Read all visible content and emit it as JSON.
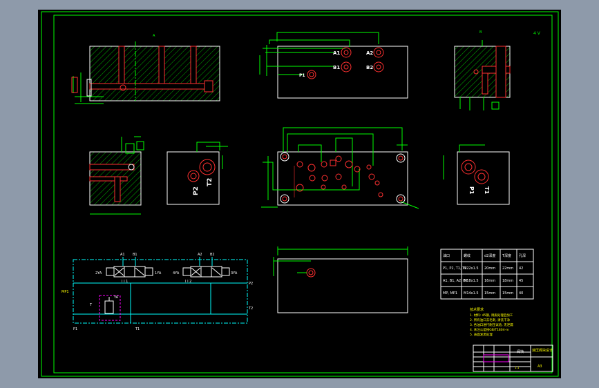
{
  "colors": {
    "background": "#8e9aaa",
    "paper": "#000000",
    "frame": "#00ff00",
    "outline": "#ffffff",
    "dimension": "#00ff00",
    "port": "#ff3030",
    "hatch": "#00c000",
    "schematic": "#00ffff",
    "valve": "#ff00ff",
    "text": "#ffff00"
  },
  "drawing": {
    "sheet_mark": "A3",
    "top_right_label": "4 V",
    "view_label_a": "A",
    "view_label_b": "B",
    "ports_top": {
      "a1": "A1",
      "a2": "A2",
      "b1": "B1",
      "b2": "B2",
      "p": "P1"
    },
    "ports_side": {
      "p2": "P2",
      "t2": "T2",
      "p1": "P1",
      "t1": "T1"
    },
    "schematic_labels": {
      "a1": "A1",
      "b1": "B1",
      "a2": "A2",
      "b2": "B2",
      "p1": "P1",
      "t1": "T1",
      "p2": "P2",
      "t2": "T2",
      "mp": "MP1",
      "t": "T",
      "coil1": "2YA",
      "coil2": "1YA",
      "coil3": "4YA",
      "coil4": "3YA",
      "mid1": "I I 1",
      "mid2": "I I 2",
      "relief": "YA"
    }
  },
  "port_table": {
    "headers": [
      "油口",
      "螺纹",
      "d2深度",
      "T深度",
      "孔深"
    ],
    "rows": [
      [
        "P1, P2, T1, T2",
        "M22x1.5",
        "20mm",
        "22mm",
        "42"
      ],
      [
        "A1, B1, A2, B2",
        "M18x1.5",
        "16mm",
        "18mm",
        "45"
      ],
      [
        "MP, MP1",
        "M14x1.5",
        "15mm",
        "15mm",
        "40"
      ]
    ]
  },
  "notes": {
    "heading": "技术要求",
    "lines": [
      "1. 材料: 45钢, 调质处理后加工",
      "2. 所有油口去毛刺, 清洗干净",
      "3. 各油口进行耐压试验, 无泄漏",
      "4. 未注公差按GB/T1804-m",
      "5. 表面发黑处理"
    ]
  },
  "title_block": {
    "title": "液压阀块设计",
    "drawing_name": "阀块",
    "scale": "1:1",
    "sheet": "A3"
  }
}
